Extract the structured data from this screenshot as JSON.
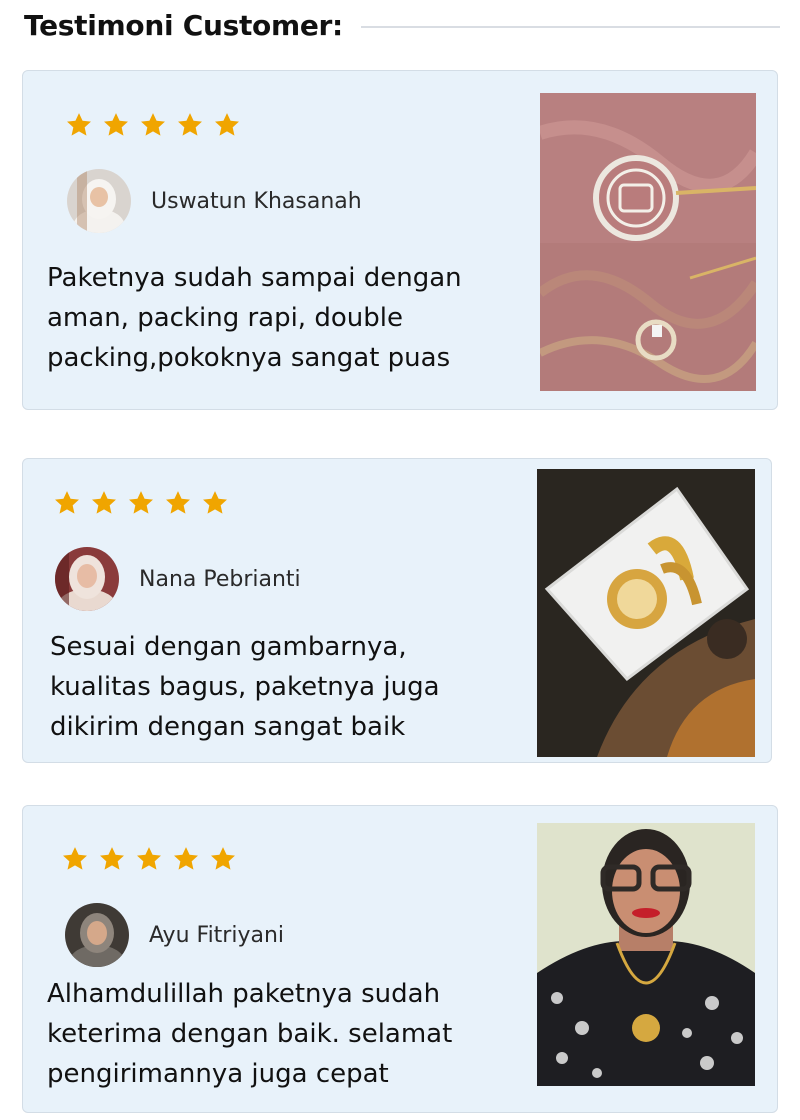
{
  "section": {
    "title": "Testimoni Customer:"
  },
  "testimonials": [
    {
      "rating": 5,
      "name": "Uswatun Khasanah",
      "text_lines": [
        "Paketnya sudah sampai dengan",
        "aman, packing rapi, double",
        "packing,pokoknya sangat puas"
      ]
    },
    {
      "rating": 5,
      "name": "Nana Pebrianti",
      "text_lines": [
        "Sesuai dengan gambarnya,",
        "kualitas bagus, paketnya juga",
        "dikirim dengan sangat baik"
      ]
    },
    {
      "rating": 5,
      "name": "Ayu Fitriyani",
      "text_lines": [
        "Alhamdulillah paketnya sudah",
        "keterima dengan baik. selamat",
        "pengirimannya juga cepat"
      ]
    }
  ],
  "colors": {
    "card_background": "#e8f2fa",
    "star": "#f0a500",
    "title": "#111111"
  },
  "icons": {
    "rating": "star-icon"
  }
}
